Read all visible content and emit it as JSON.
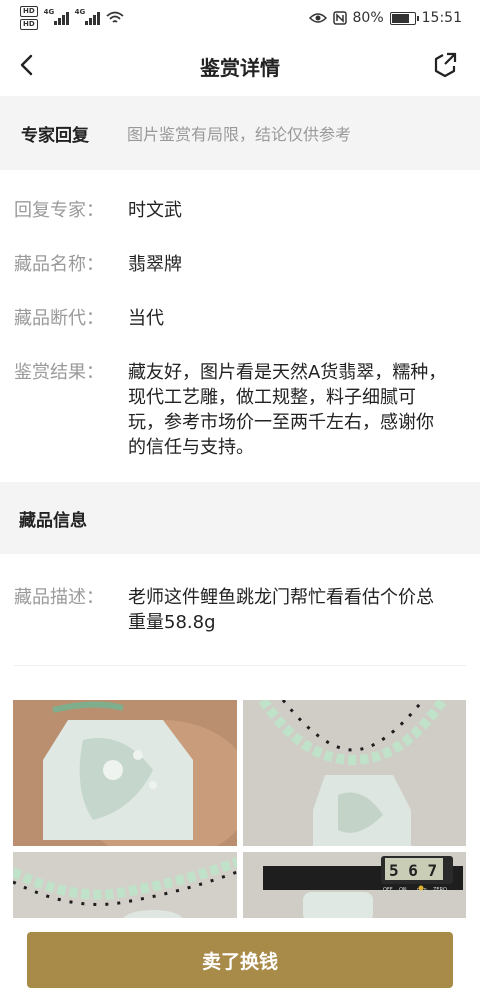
{
  "status_bar": {
    "hd1": "HD",
    "hd2": "HD",
    "sig1": "4G",
    "sig2": "4G",
    "battery": "80%",
    "battery_level": 0.8,
    "time": "15:51"
  },
  "header": {
    "title": "鉴赏详情"
  },
  "reply_section": {
    "label": "专家回复",
    "note": "图片鉴赏有局限，结论仅供参考",
    "fields": [
      {
        "key": "回复专家：",
        "value": "时文武"
      },
      {
        "key": "藏品名称：",
        "value": "翡翠牌"
      },
      {
        "key": "藏品断代：",
        "value": "当代"
      },
      {
        "key": "鉴赏结果：",
        "value": "藏友好，图片看是天然A货翡翠，糯种，现代工艺雕，做工规整，料子细腻可玩，参考市场价一至两千左右，感谢你的信任与支持。"
      }
    ]
  },
  "item_section": {
    "label": "藏品信息",
    "fields": [
      {
        "key": "藏品描述：",
        "value": "老师这件鲤鱼跳龙门帮忙看看估个价总重量58.8g"
      }
    ]
  },
  "photos": {
    "caliper_reading": "5 6 7",
    "caliper_labels": [
      "OFF",
      "ON",
      "mm",
      "ZERO"
    ]
  },
  "cta": {
    "label": "卖了换钱"
  }
}
